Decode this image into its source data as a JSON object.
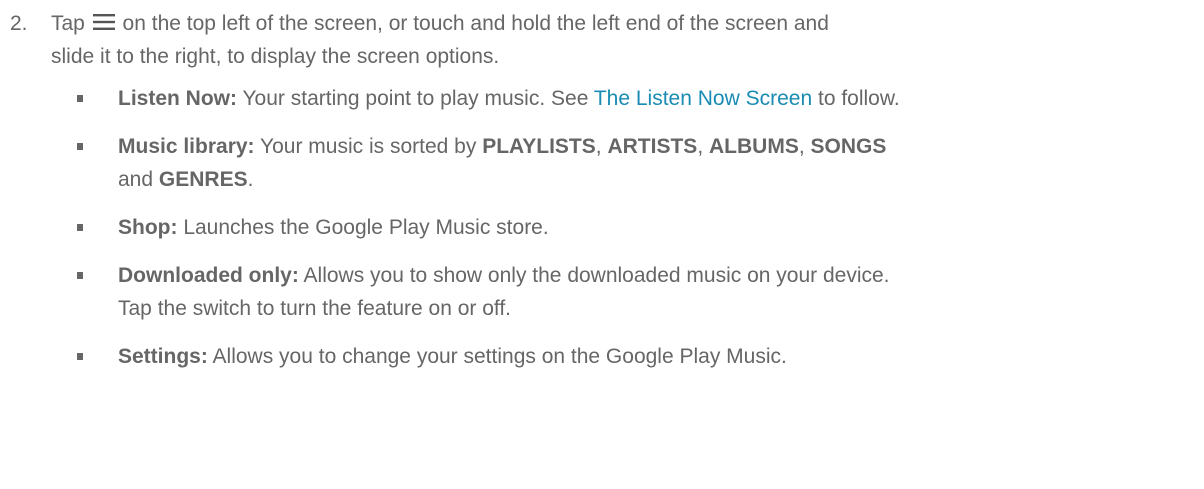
{
  "step": {
    "number": "2.",
    "before_icon": "Tap",
    "icon": "menu-icon",
    "after_icon_line1": "on the top left of the screen, or touch and hold the left end of the screen and",
    "line2": "slide it to the right, to display the screen options."
  },
  "colors": {
    "text": "#666666",
    "link": "#1a8bb3"
  },
  "items": [
    {
      "term": "Listen Now:",
      "text_before_link": "Your starting point to play music. See",
      "link": "The Listen Now Screen",
      "text_after_link": "to follow."
    },
    {
      "term": "Music library:",
      "text": "Your music is sorted by",
      "k1": "PLAYLISTS",
      "k2": "ARTISTS",
      "k3": "ALBUMS",
      "k4": "SONGS",
      "and": "and",
      "k5": "GENRES",
      "comma": ",",
      "period": "."
    },
    {
      "term": "Shop:",
      "text": "Launches the Google Play Music store."
    },
    {
      "term": "Downloaded only:",
      "line1": "Allows you to show only the downloaded music on your device.",
      "line2": "Tap the switch to turn the feature on or off."
    },
    {
      "term": "Settings:",
      "text": "Allows you to change your settings on the Google Play Music."
    }
  ]
}
